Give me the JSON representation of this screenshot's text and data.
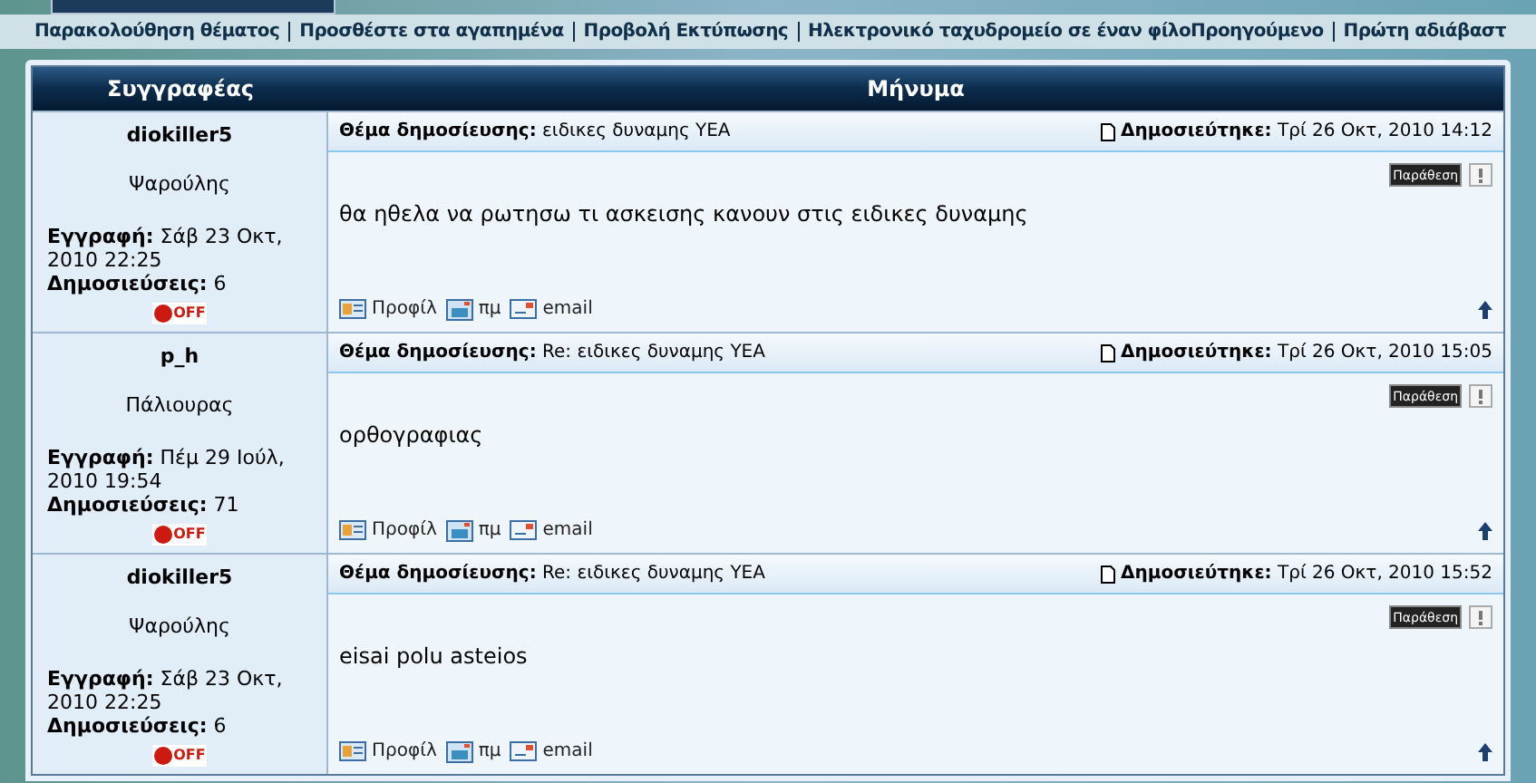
{
  "links": [
    "Παρακολούθηση θέματος",
    "Προσθέστε στα αγαπημένα",
    "Προβολή Εκτύπωσης",
    "Ηλεκτρονικό ταχυδρομείο σε έναν φίλο",
    "Προηγούμενο",
    "Πρώτη αδιάβαστ"
  ],
  "table": {
    "columns": [
      "Συγγραφέας",
      "Μήνυμα"
    ],
    "posts": [
      {
        "author": "diokiller5",
        "rank": "Ψαρούλης",
        "joined_label": "Εγγραφή:",
        "joined": "Σάβ 23 Οκτ, 2010 22:25",
        "posts_label": "Δημοσιεύσεις:",
        "posts": "6",
        "online": false,
        "status": "OFF",
        "subject_label": "Θέμα δημοσίευσης:",
        "subject": "ειδικες δυναμης ΥΕΑ",
        "posted_label": "Δημοσιεύτηκε:",
        "posted": "Τρί 26 Οκτ, 2010 14:12",
        "quote": "Παράθεση",
        "body": "θα ηθελα να ρωτησω τι ασκεισης κανουν στις ειδικες δυναμης",
        "actions": [
          "Προφίλ",
          "πμ",
          "email"
        ]
      },
      {
        "author": "p_h",
        "rank": "Πάλιουρας",
        "joined_label": "Εγγραφή:",
        "joined": "Πέμ 29 Ιούλ, 2010 19:54",
        "posts_label": "Δημοσιεύσεις:",
        "posts": "71",
        "online": false,
        "status": "OFF",
        "subject_label": "Θέμα δημοσίευσης:",
        "subject": "Re: ειδικες δυναμης ΥΕΑ",
        "posted_label": "Δημοσιεύτηκε:",
        "posted": "Τρί 26 Οκτ, 2010 15:05",
        "quote": "Παράθεση",
        "body": "ορθογραφιας",
        "actions": [
          "Προφίλ",
          "πμ",
          "email"
        ]
      },
      {
        "author": "diokiller5",
        "rank": "Ψαρούλης",
        "joined_label": "Εγγραφή:",
        "joined": "Σάβ 23 Οκτ, 2010 22:25",
        "posts_label": "Δημοσιεύσεις:",
        "posts": "6",
        "online": false,
        "status": "OFF",
        "subject_label": "Θέμα δημοσίευσης:",
        "subject": "Re: ειδικες δυναμης ΥΕΑ",
        "posted_label": "Δημοσιεύτηκε:",
        "posted": "Τρί 26 Οκτ, 2010 15:52",
        "quote": "Παράθεση",
        "body": "eisai polu asteios",
        "actions": [
          "Προφίλ",
          "πμ",
          "email"
        ]
      }
    ]
  }
}
